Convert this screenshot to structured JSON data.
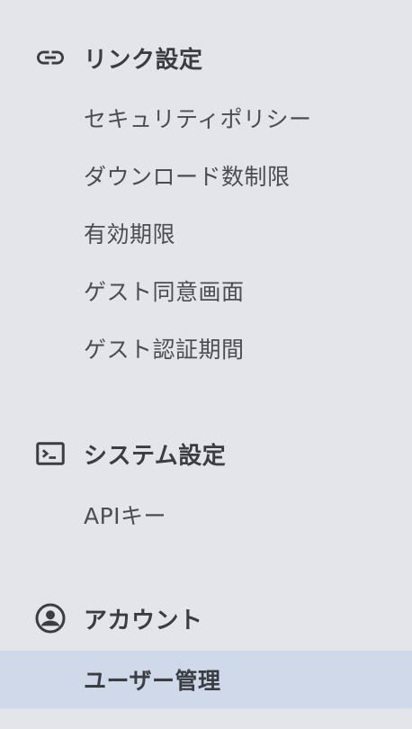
{
  "sections": [
    {
      "icon": "link-icon",
      "title": "リンク設定",
      "items": [
        {
          "label": "セキュリティポリシー"
        },
        {
          "label": "ダウンロード数制限"
        },
        {
          "label": "有効期限"
        },
        {
          "label": "ゲスト同意画面"
        },
        {
          "label": "ゲスト認証期間"
        }
      ]
    },
    {
      "icon": "terminal-icon",
      "title": "システム設定",
      "items": [
        {
          "label": "APIキー"
        }
      ]
    },
    {
      "icon": "account-circle-icon",
      "title": "アカウント",
      "items": [
        {
          "label": "ユーザー管理",
          "active": true
        }
      ]
    }
  ],
  "colors": {
    "background": "#e4e5ea",
    "active_background": "#cfd9e9",
    "text": "#3c3f44"
  }
}
